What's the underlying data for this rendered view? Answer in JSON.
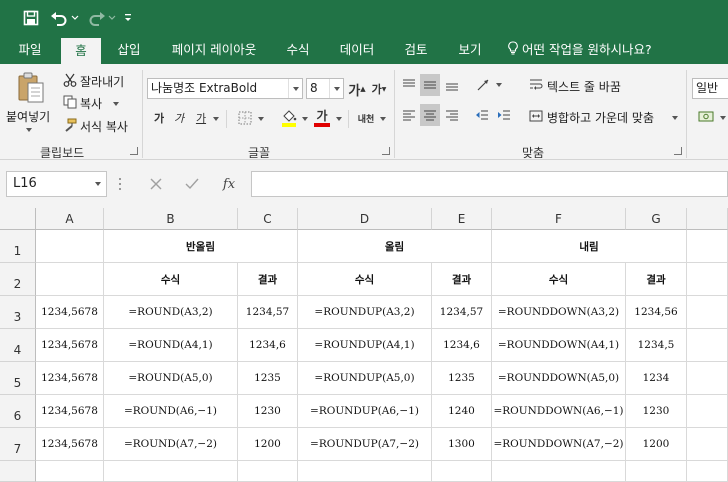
{
  "quick_access": {
    "save_icon": "save-icon",
    "undo_icon": "undo-icon",
    "redo_icon": "redo-icon",
    "customize_icon": "customize-qat-icon"
  },
  "tabs": [
    {
      "label": "파일",
      "active": false
    },
    {
      "label": "홈",
      "active": true
    },
    {
      "label": "삽입",
      "active": false
    },
    {
      "label": "페이지 레이아웃",
      "active": false
    },
    {
      "label": "수식",
      "active": false
    },
    {
      "label": "데이터",
      "active": false
    },
    {
      "label": "검토",
      "active": false
    },
    {
      "label": "보기",
      "active": false
    }
  ],
  "tell_me": "어떤 작업을 원하시나요?",
  "ribbon": {
    "clipboard": {
      "paste": "붙여넣기",
      "cut": "잘라내기",
      "copy": "복사",
      "format_painter": "서식 복사",
      "label": "클립보드"
    },
    "font": {
      "name": "나눔명조 ExtraBold",
      "size": "8",
      "label": "글꼴",
      "grow": "가",
      "shrink": "가",
      "bold": "가",
      "italic": "가",
      "underline": "가",
      "font_color": "가",
      "phonetic": "내천",
      "font_color_hex": "#e00000",
      "fill_color_hex": "#ffff00"
    },
    "alignment": {
      "wrap_text": "텍스트 줄 바꿈",
      "merge_center": "병합하고 가운데 맞춤",
      "label": "맞춤"
    },
    "number": {
      "format": "일반"
    }
  },
  "formula_bar": {
    "name_box": "L16",
    "fx": "fx",
    "value": ""
  },
  "sheet": {
    "columns": [
      "A",
      "B",
      "C",
      "D",
      "E",
      "F",
      "G"
    ],
    "rows": [
      "1",
      "2",
      "3",
      "4",
      "5",
      "6",
      "7"
    ],
    "headers": {
      "round": "반올림",
      "roundup": "올림",
      "rounddown": "내림",
      "formula": "수식",
      "result": "결과"
    },
    "data": [
      {
        "a": "1234,5678",
        "b": "=ROUND(A3,2)",
        "c": "1234,57",
        "d": "=ROUNDUP(A3,2)",
        "e": "1234,57",
        "f": "=ROUNDDOWN(A3,2)",
        "g": "1234,56"
      },
      {
        "a": "1234,5678",
        "b": "=ROUND(A4,1)",
        "c": "1234,6",
        "d": "=ROUNDUP(A4,1)",
        "e": "1234,6",
        "f": "=ROUNDDOWN(A4,1)",
        "g": "1234,5"
      },
      {
        "a": "1234,5678",
        "b": "=ROUND(A5,0)",
        "c": "1235",
        "d": "=ROUNDUP(A5,0)",
        "e": "1235",
        "f": "=ROUNDDOWN(A5,0)",
        "g": "1234"
      },
      {
        "a": "1234,5678",
        "b": "=ROUND(A6,−1)",
        "c": "1230",
        "d": "=ROUNDUP(A6,−1)",
        "e": "1240",
        "f": "=ROUNDDOWN(A6,−1)",
        "g": "1230"
      },
      {
        "a": "1234,5678",
        "b": "=ROUND(A7,−2)",
        "c": "1200",
        "d": "=ROUNDUP(A7,−2)",
        "e": "1300",
        "f": "=ROUNDDOWN(A7,−2)",
        "g": "1200"
      }
    ]
  },
  "colors": {
    "excel_green": "#217346",
    "ribbon_bg": "#f3f3f3"
  }
}
